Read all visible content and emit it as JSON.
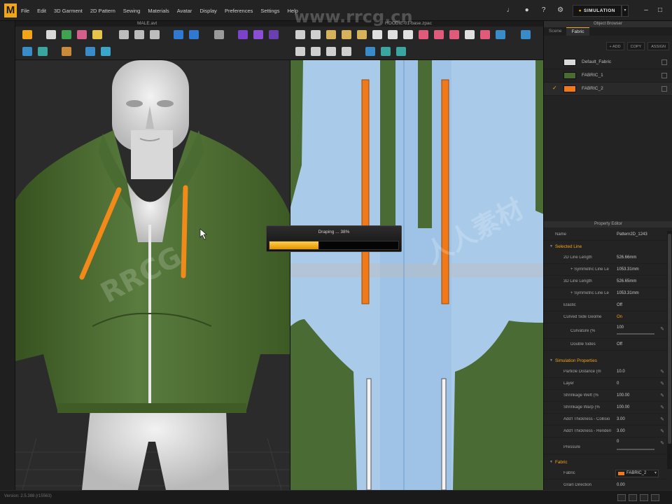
{
  "app": {
    "logo": "M",
    "menu": [
      "File",
      "Edit",
      "3D Garment",
      "2D Pattern",
      "Sewing",
      "Materials",
      "Avatar",
      "Display",
      "Preferences",
      "Settings",
      "Help"
    ],
    "simulation_label": "SIMULATION"
  },
  "viewport3d": {
    "title": "MALE.avt"
  },
  "viewport2d": {
    "title": "HOODIE-01-base.zpac"
  },
  "progress": {
    "label": "Draping ... 38%",
    "value": 0.38
  },
  "object_browser": {
    "title": "Object Browser",
    "tabs": [
      "Scene",
      "Fabric"
    ],
    "active_tab": "Fabric",
    "actions": [
      "+ ADD",
      "COPY",
      "ASSIGN"
    ],
    "fabrics": [
      {
        "name": "Default_Fabric",
        "color": "#d9d9d9",
        "selected": false
      },
      {
        "name": "FABRIC_1",
        "color": "#4b6b34",
        "selected": false
      },
      {
        "name": "FABRIC_2",
        "color": "#f07a1a",
        "selected": true
      }
    ]
  },
  "property_editor": {
    "title": "Property Editor",
    "name_label": "Name",
    "name_value": "Pattern2D_1243",
    "selected_line": {
      "section": "Selected Line",
      "rows": [
        {
          "label": "2D Line Length",
          "value": "526.66mm"
        },
        {
          "label": "+ Symmetric Line Le",
          "value": "1053.31mm"
        },
        {
          "label": "3D Line Length",
          "value": "526.65mm"
        },
        {
          "label": "+ Symmetric Line Le",
          "value": "1053.31mm"
        },
        {
          "label": "Elastic",
          "value": "Off"
        },
        {
          "label": "Curved Side Geome",
          "value": "On"
        },
        {
          "label": "Curvature (%",
          "value": "100"
        },
        {
          "label": "Double Sides",
          "value": "Off"
        }
      ]
    },
    "simulation": {
      "section": "Simulation Properties",
      "rows": [
        {
          "label": "Particle Distance (m",
          "value": "10.0"
        },
        {
          "label": "Layer",
          "value": "0"
        },
        {
          "label": "Shrinkage Weft (%",
          "value": "100.00"
        },
        {
          "label": "Shrinkage Warp (%",
          "value": "100.00"
        },
        {
          "label": "Add'l Thickness - Collisio",
          "value": "3.00"
        },
        {
          "label": "Add'l Thickness - Renderi",
          "value": "3.00"
        },
        {
          "label": "Pressure",
          "value": "0"
        }
      ]
    },
    "fabric": {
      "section": "Fabric",
      "rows": [
        {
          "label": "Fabric",
          "value": "FABRIC_2"
        },
        {
          "label": "Grain Direction",
          "value": "0.00"
        }
      ]
    }
  },
  "status": {
    "version": "Version: 2.5.388    (r15563)"
  },
  "watermarks": [
    "RRCG",
    "人人素材",
    "www.rrcg.cn"
  ],
  "colors": {
    "accent": "#f2a516",
    "garment": "#4b6b34",
    "drawcord": "#f07a1a",
    "pattern_bg": "#9fc3e6"
  }
}
